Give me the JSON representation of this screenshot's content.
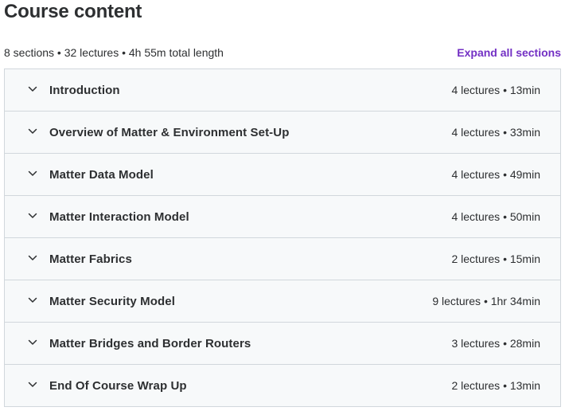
{
  "header": {
    "title": "Course content",
    "summary": "8 sections • 32 lectures • 4h 55m total length",
    "expand_label": "Expand all sections"
  },
  "sections": [
    {
      "title": "Introduction",
      "meta": "4 lectures • 13min",
      "icon": "chevron-down-icon"
    },
    {
      "title": "Overview of Matter & Environment Set-Up",
      "meta": "4 lectures • 33min",
      "icon": "chevron-down-icon"
    },
    {
      "title": "Matter Data Model",
      "meta": "4 lectures • 49min",
      "icon": "chevron-down-icon"
    },
    {
      "title": "Matter Interaction Model",
      "meta": "4 lectures • 50min",
      "icon": "chevron-down-icon"
    },
    {
      "title": "Matter Fabrics",
      "meta": "2 lectures • 15min",
      "icon": "chevron-down-icon"
    },
    {
      "title": "Matter Security Model",
      "meta": "9 lectures • 1hr 34min",
      "icon": "chevron-down-icon"
    },
    {
      "title": "Matter Bridges and Border Routers",
      "meta": "3 lectures • 28min",
      "icon": "chevron-down-icon"
    },
    {
      "title": "End Of Course Wrap Up",
      "meta": "2 lectures • 13min",
      "icon": "chevron-down-icon"
    }
  ],
  "colors": {
    "accent": "#7330c4",
    "text": "#2d2f31",
    "section_bg": "#f7f9fa",
    "border": "#d1d7dc"
  }
}
